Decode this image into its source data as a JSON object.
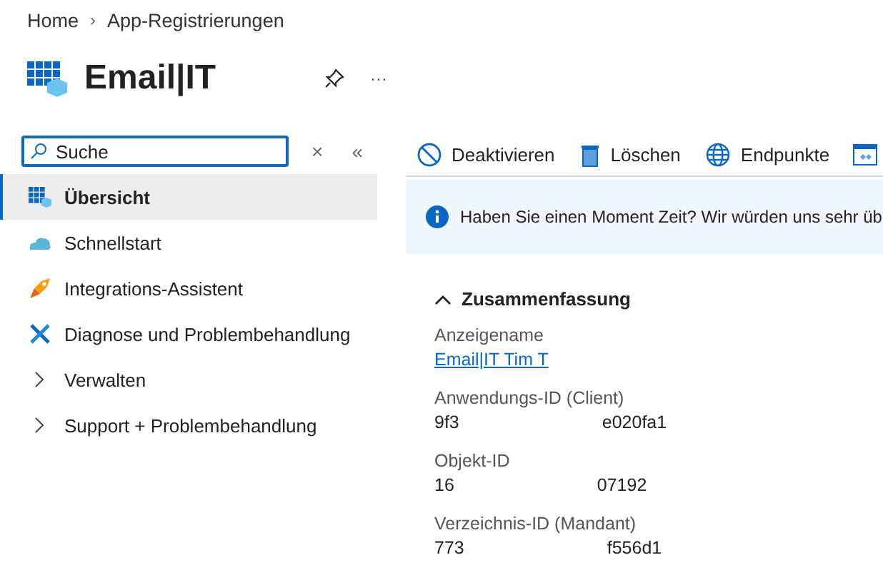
{
  "breadcrumb": [
    "Home",
    "›",
    "App-Registrierungen"
  ],
  "title": "Email|IT",
  "more": "···",
  "search": {
    "value": "Suche",
    "clear": "×",
    "collapse": "«"
  },
  "sidebar": {
    "items": [
      {
        "label": "Übersicht",
        "kind": "page",
        "selected": true
      },
      {
        "label": "Schnellstart",
        "kind": "page",
        "selected": false
      },
      {
        "label": "Integrations-Assistent",
        "kind": "page",
        "selected": false
      },
      {
        "label": "Diagnose und Problembehandlung",
        "kind": "page",
        "selected": false
      },
      {
        "label": "Verwalten",
        "kind": "group",
        "expanded": false,
        "selected": false
      },
      {
        "label": "Support + Problembehandlung",
        "kind": "group",
        "expanded": false,
        "selected": false
      }
    ]
  },
  "toolbar": [
    {
      "label": "Deaktivieren"
    },
    {
      "label": "Löschen"
    },
    {
      "label": "Endpunkte"
    }
  ],
  "banner": "Haben Sie einen Moment Zeit? Wir würden uns sehr üb",
  "summary": {
    "heading": "Zusammenfassung",
    "expanded": true,
    "fields": [
      {
        "label": "Anzeigename",
        "kind": "link",
        "value": "Email|IT Tim T"
      },
      {
        "label": "Anwendungs-ID (Client)",
        "kind": "redacted",
        "start": "9f3",
        "end": "e020fa1"
      },
      {
        "label": "Objekt-ID",
        "kind": "redacted",
        "start": "16",
        "end": "07192"
      },
      {
        "label": "Verzeichnis-ID (Mandant)",
        "kind": "redacted",
        "start": "773",
        "end": "f556d1"
      }
    ]
  }
}
